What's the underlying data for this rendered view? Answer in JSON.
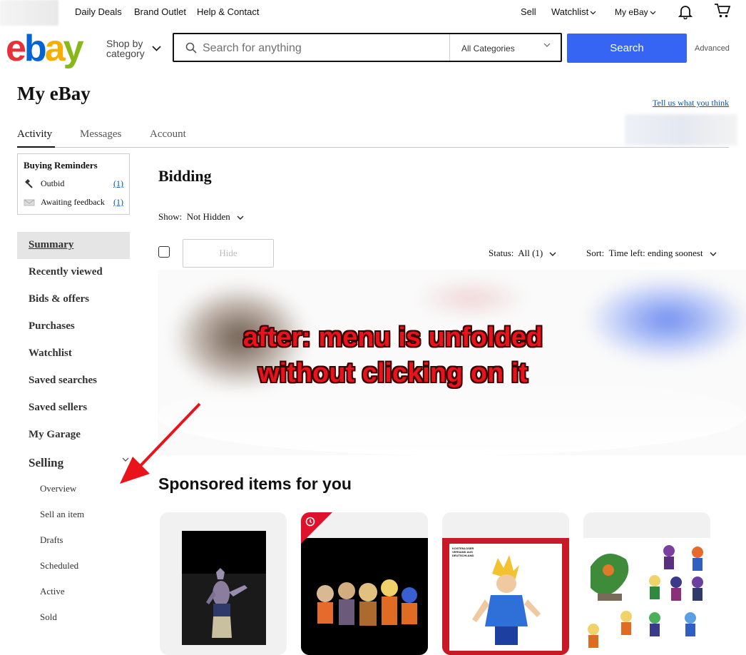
{
  "topbar": {
    "links": [
      "Daily Deals",
      "Brand Outlet",
      "Help & Contact"
    ],
    "sell": "Sell",
    "watchlist": "Watchlist",
    "myebay": "My eBay"
  },
  "header": {
    "logo": [
      "e",
      "b",
      "a",
      "y"
    ],
    "shop_by_line1": "Shop by",
    "shop_by_line2": "category",
    "search_placeholder": "Search for anything",
    "category": "All Categories",
    "search_button": "Search",
    "advanced": "Advanced"
  },
  "page": {
    "title": "My eBay",
    "feedback_link": "Tell us what you think",
    "tabs": [
      "Activity",
      "Messages",
      "Account"
    ]
  },
  "reminders": {
    "title": "Buying Reminders",
    "items": [
      {
        "label": "Outbid",
        "count": "(1)"
      },
      {
        "label": "Awaiting feedback",
        "count": "(1)"
      }
    ]
  },
  "nav": {
    "items": [
      "Summary",
      "Recently viewed",
      "Bids & offers",
      "Purchases",
      "Watchlist",
      "Saved searches",
      "Saved sellers",
      "My Garage"
    ],
    "selling": "Selling",
    "selling_items": [
      "Overview",
      "Sell an item",
      "Drafts",
      "Scheduled",
      "Active",
      "Sold"
    ]
  },
  "bidding": {
    "title": "Bidding",
    "show_label": "Show:",
    "show_value": "Not Hidden",
    "hide_button": "Hide",
    "status_label": "Status:",
    "status_value": "All (1)",
    "sort_label": "Sort:",
    "sort_value": "Time left: ending soonest"
  },
  "annotation": {
    "line1": "after: menu is unfolded",
    "line2": "without clicking on it"
  },
  "sponsored": {
    "title": "Sponsored items for you",
    "card3_badge_text": "KOSTENLOSER VERSAND AUS DEUTSCHLAND"
  },
  "colors": {
    "search_button": "#3665f3",
    "link": "#0654ba",
    "annotation": "#e8131b",
    "arrow": "#e8131b"
  }
}
